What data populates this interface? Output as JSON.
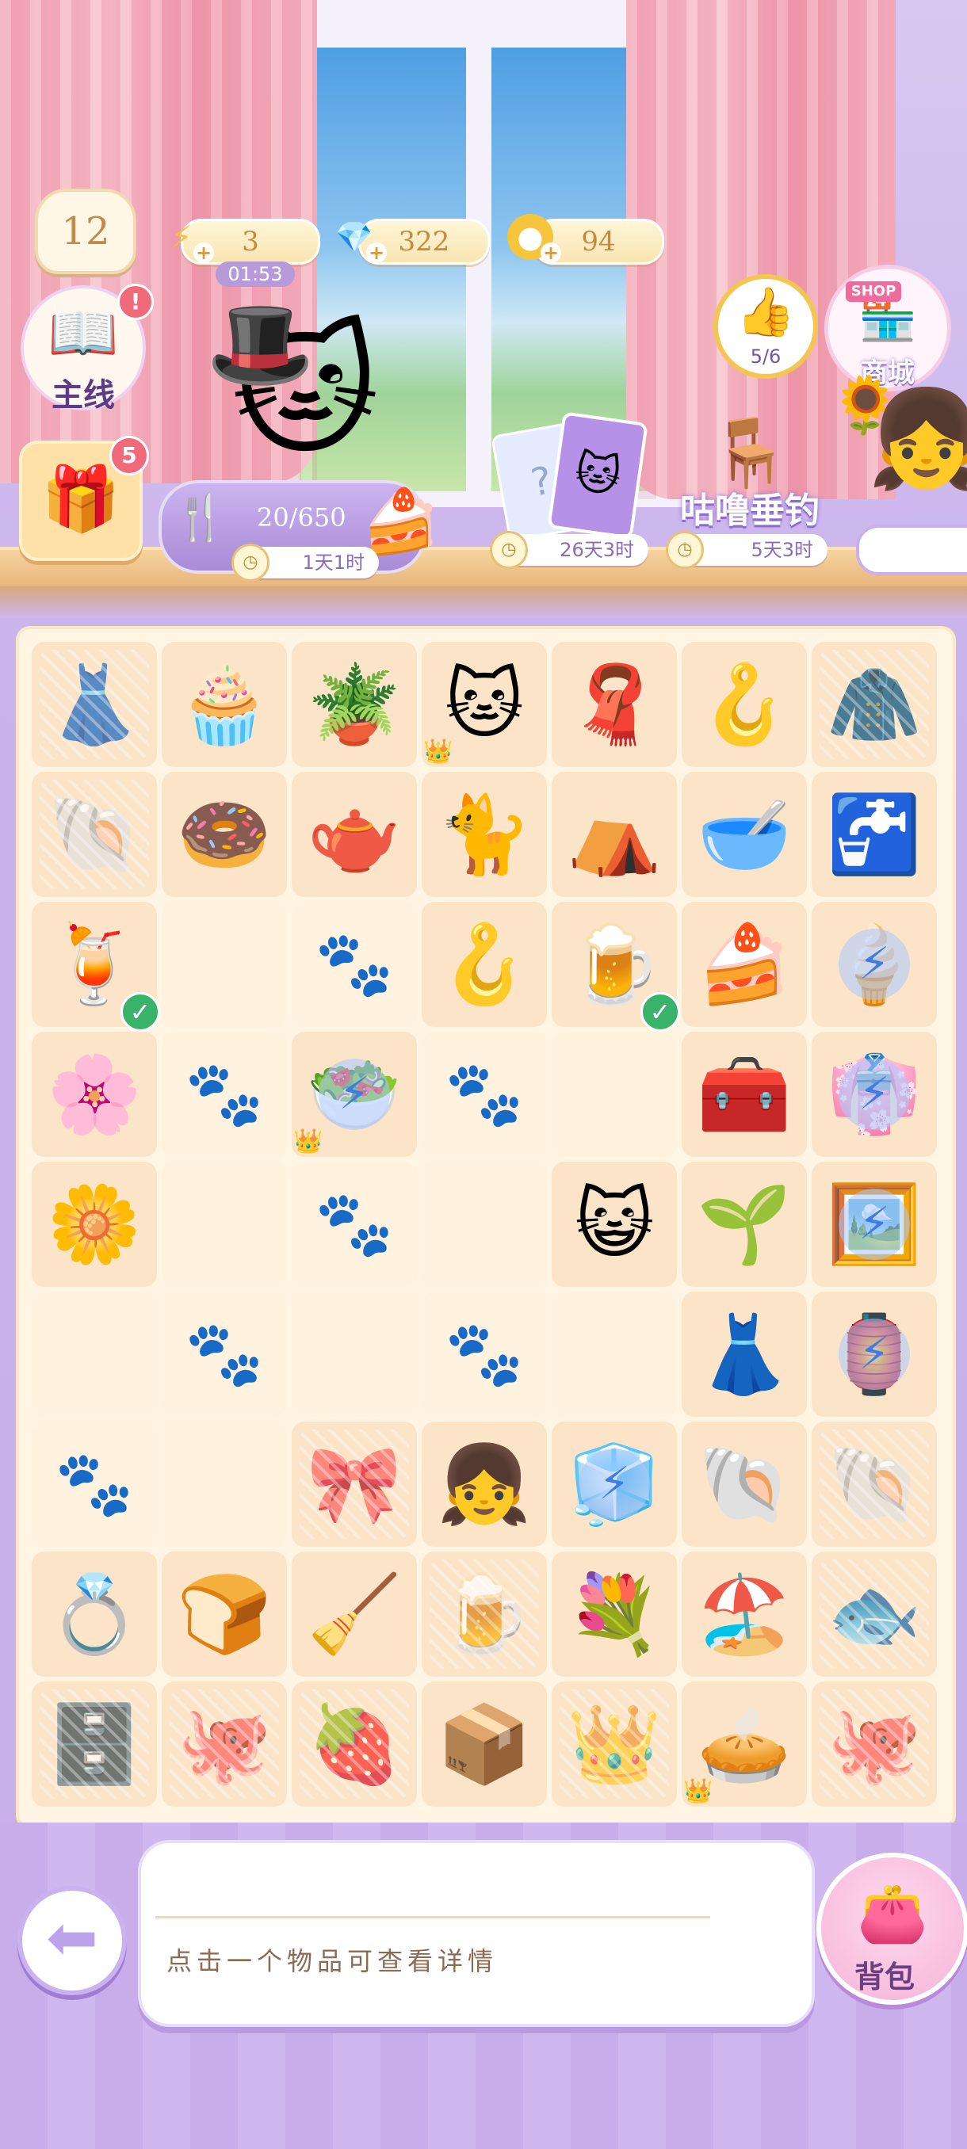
{
  "header": {
    "level": "12",
    "quest_label": "主线",
    "quest_alert": "!",
    "chest_badge": "5",
    "energy": "3",
    "energy_timer": "01:53",
    "gems": "322",
    "coins": "94",
    "progress_text": "20/650",
    "event_timer": "1天1时",
    "card_timer": "26天3时",
    "fishing_label": "咕噜垂钓",
    "fishing_timer": "5天3时",
    "likes_text": "5/6",
    "shop_sign": "SHOP",
    "shop_label": "商城"
  },
  "board": {
    "rows": [
      [
        {
          "icon": "👗",
          "lock": true
        },
        {
          "icon": "🧁"
        },
        {
          "icon": "🪴"
        },
        {
          "icon": "🐱",
          "star": true
        },
        {
          "icon": "🧣"
        },
        {
          "icon": "🪝"
        },
        {
          "icon": "🧥",
          "lock": true
        }
      ],
      [
        {
          "icon": "🐚",
          "lock": true
        },
        {
          "icon": "🍩"
        },
        {
          "icon": "🫖"
        },
        {
          "icon": "🐈"
        },
        {
          "icon": "⛺"
        },
        {
          "icon": "🥣"
        },
        {
          "icon": "🚰"
        }
      ],
      [
        {
          "icon": "🍹",
          "check": true
        },
        {
          "empty": true
        },
        {
          "paw": true
        },
        {
          "icon": "🪝"
        },
        {
          "icon": "🍺",
          "check": true
        },
        {
          "icon": "🍰"
        },
        {
          "icon": "🍦",
          "bolt": true
        }
      ],
      [
        {
          "icon": "🌸"
        },
        {
          "paw": true
        },
        {
          "icon": "🥗",
          "bolt": true,
          "star": true
        },
        {
          "paw": true
        },
        {
          "empty": true
        },
        {
          "icon": "🧰"
        },
        {
          "icon": "👘",
          "bolt": true
        }
      ],
      [
        {
          "icon": "🌼"
        },
        {
          "empty": true
        },
        {
          "paw": true
        },
        {
          "empty": true
        },
        {
          "icon": "😺"
        },
        {
          "icon": "🌱"
        },
        {
          "icon": "🖼️",
          "bolt": true
        }
      ],
      [
        {
          "empty": true
        },
        {
          "paw": true
        },
        {
          "empty": true
        },
        {
          "paw": true
        },
        {
          "empty": true
        },
        {
          "icon": "👗"
        },
        {
          "icon": "🏮",
          "bolt": true
        }
      ],
      [
        {
          "paw": true
        },
        {
          "empty": true
        },
        {
          "icon": "🎀",
          "lock": true
        },
        {
          "icon": "👧"
        },
        {
          "icon": "🧊",
          "bolt": true
        },
        {
          "icon": "🐚"
        },
        {
          "icon": "🐚",
          "lock": true
        }
      ],
      [
        {
          "icon": "💍"
        },
        {
          "icon": "🍞"
        },
        {
          "icon": "🧹"
        },
        {
          "icon": "🍺",
          "lock": true
        },
        {
          "icon": "💐"
        },
        {
          "icon": "🏖️"
        },
        {
          "icon": "🐟",
          "lock": true
        }
      ],
      [
        {
          "icon": "🗄️",
          "lock": true
        },
        {
          "icon": "🐙",
          "lock": true
        },
        {
          "icon": "🍓",
          "lock": true
        },
        {
          "icon": "📦"
        },
        {
          "icon": "👑",
          "lock": true
        },
        {
          "icon": "🥧",
          "star": true
        },
        {
          "icon": "🐙",
          "lock": true
        }
      ]
    ]
  },
  "info": {
    "hint": "点击一个物品可查看详情"
  },
  "bag": {
    "label": "背包"
  },
  "colors": {
    "background": "#c9b1ec",
    "board": "#fff5e2",
    "cell": "#fbe4c7",
    "accent": "#f06a7c"
  }
}
